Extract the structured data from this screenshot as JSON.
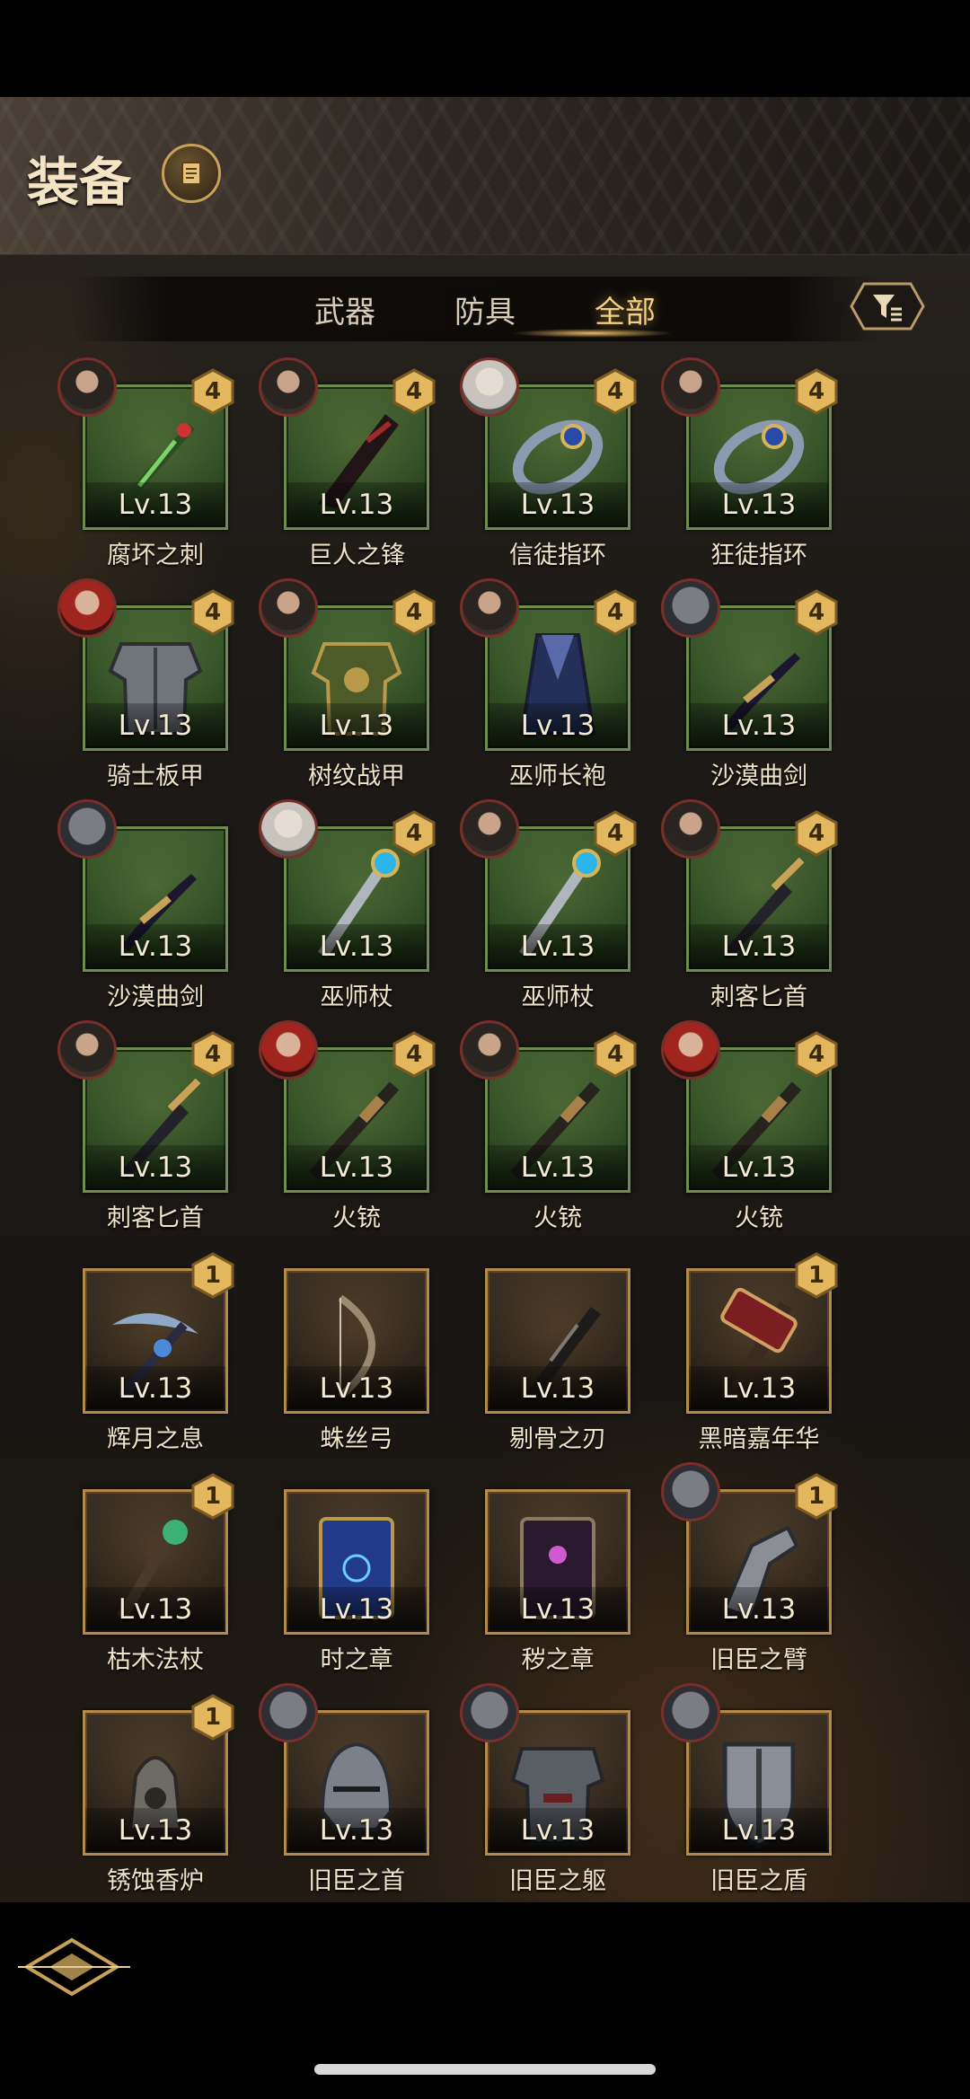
{
  "header": {
    "title": "装备"
  },
  "tabs": [
    {
      "label": "武器",
      "active": false
    },
    {
      "label": "防具",
      "active": false
    },
    {
      "label": "全部",
      "active": true
    }
  ],
  "colors": {
    "accent": "#f2cf82",
    "frame_green": "#6f8c4c",
    "frame_gold": "#b38a4c"
  },
  "items": [
    {
      "name": "腐坏之刺",
      "level": "Lv.13",
      "rank": "4",
      "frame": "green",
      "avatar": "dark",
      "icon": "thorn-sword-icon"
    },
    {
      "name": "巨人之锋",
      "level": "Lv.13",
      "rank": "4",
      "frame": "green",
      "avatar": "dark",
      "icon": "great-sword-icon"
    },
    {
      "name": "信徒指环",
      "level": "Lv.13",
      "rank": "4",
      "frame": "green",
      "avatar": "white",
      "icon": "ring-icon"
    },
    {
      "name": "狂徒指环",
      "level": "Lv.13",
      "rank": "4",
      "frame": "green",
      "avatar": "dark",
      "icon": "ring-icon"
    },
    {
      "name": "骑士板甲",
      "level": "Lv.13",
      "rank": "4",
      "frame": "green",
      "avatar": "red",
      "icon": "plate-armor-icon"
    },
    {
      "name": "树纹战甲",
      "level": "Lv.13",
      "rank": "4",
      "frame": "green",
      "avatar": "dark",
      "icon": "armor-icon"
    },
    {
      "name": "巫师长袍",
      "level": "Lv.13",
      "rank": "4",
      "frame": "green",
      "avatar": "dark",
      "icon": "robe-icon"
    },
    {
      "name": "沙漠曲剑",
      "level": "Lv.13",
      "rank": "4",
      "frame": "green",
      "avatar": "helm",
      "icon": "scimitar-icon"
    },
    {
      "name": "沙漠曲剑",
      "level": "Lv.13",
      "rank": "",
      "frame": "green",
      "avatar": "helm",
      "icon": "scimitar-icon"
    },
    {
      "name": "巫师杖",
      "level": "Lv.13",
      "rank": "4",
      "frame": "green",
      "avatar": "white",
      "icon": "staff-icon"
    },
    {
      "name": "巫师杖",
      "level": "Lv.13",
      "rank": "4",
      "frame": "green",
      "avatar": "dark",
      "icon": "staff-icon"
    },
    {
      "name": "刺客匕首",
      "level": "Lv.13",
      "rank": "4",
      "frame": "green",
      "avatar": "dark",
      "icon": "dagger-icon"
    },
    {
      "name": "刺客匕首",
      "level": "Lv.13",
      "rank": "4",
      "frame": "green",
      "avatar": "dark",
      "icon": "dagger-icon"
    },
    {
      "name": "火铳",
      "level": "Lv.13",
      "rank": "4",
      "frame": "green",
      "avatar": "red",
      "icon": "musket-icon"
    },
    {
      "name": "火铳",
      "level": "Lv.13",
      "rank": "4",
      "frame": "green",
      "avatar": "dark",
      "icon": "musket-icon"
    },
    {
      "name": "火铳",
      "level": "Lv.13",
      "rank": "4",
      "frame": "green",
      "avatar": "red",
      "icon": "musket-icon"
    },
    {
      "name": "辉月之息",
      "level": "Lv.13",
      "rank": "1",
      "frame": "gold",
      "avatar": "",
      "icon": "crescent-blade-icon"
    },
    {
      "name": "蛛丝弓",
      "level": "Lv.13",
      "rank": "",
      "frame": "gold",
      "avatar": "",
      "icon": "bow-icon"
    },
    {
      "name": "剔骨之刃",
      "level": "Lv.13",
      "rank": "",
      "frame": "gold",
      "avatar": "",
      "icon": "blade-icon"
    },
    {
      "name": "黑暗嘉年华",
      "level": "Lv.13",
      "rank": "1",
      "frame": "gold",
      "avatar": "",
      "icon": "hammer-icon"
    },
    {
      "name": "枯木法杖",
      "level": "Lv.13",
      "rank": "1",
      "frame": "gold",
      "avatar": "",
      "icon": "wood-staff-icon"
    },
    {
      "name": "时之章",
      "level": "Lv.13",
      "rank": "",
      "frame": "gold",
      "avatar": "",
      "icon": "tome-icon"
    },
    {
      "name": "秽之章",
      "level": "Lv.13",
      "rank": "",
      "frame": "gold",
      "avatar": "",
      "icon": "dark-tome-icon"
    },
    {
      "name": "旧臣之臂",
      "level": "Lv.13",
      "rank": "1",
      "frame": "gold",
      "avatar": "helm",
      "icon": "gauntlet-icon"
    },
    {
      "name": "锈蚀香炉",
      "level": "Lv.13",
      "rank": "1",
      "frame": "gold",
      "avatar": "",
      "icon": "censer-icon"
    },
    {
      "name": "旧臣之首",
      "level": "Lv.13",
      "rank": "",
      "frame": "gold",
      "avatar": "helm",
      "icon": "helmet-icon"
    },
    {
      "name": "旧臣之躯",
      "level": "Lv.13",
      "rank": "",
      "frame": "gold",
      "avatar": "helm",
      "icon": "chest-armor-icon"
    },
    {
      "name": "旧臣之盾",
      "level": "Lv.13",
      "rank": "",
      "frame": "gold",
      "avatar": "helm",
      "icon": "shield-icon"
    }
  ]
}
